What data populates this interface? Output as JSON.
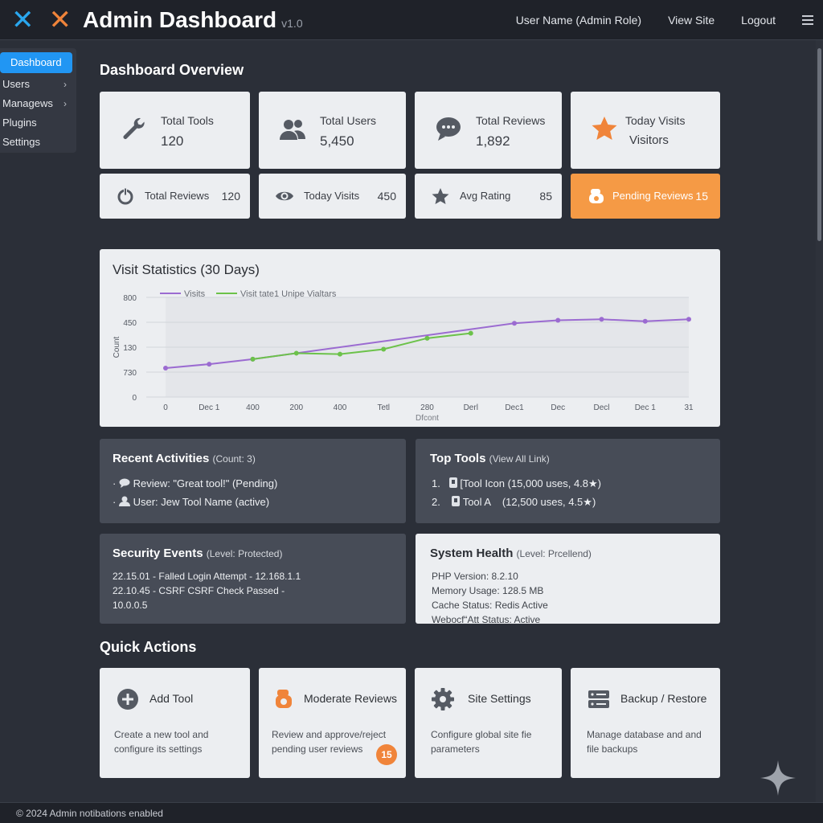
{
  "header": {
    "title": "Admin Dashboard",
    "version": "v1.0",
    "user": "User Name (Admin Role)",
    "view_site": "View Site",
    "logout": "Logout"
  },
  "sidebar": {
    "items": [
      {
        "label": "Dashboard",
        "active": true
      },
      {
        "label": "Users",
        "has_children": true
      },
      {
        "label": "Managews",
        "has_children": true
      },
      {
        "label": "Plugins"
      },
      {
        "label": "Settings"
      }
    ]
  },
  "overview": {
    "title": "Dashboard Overview",
    "big_stats": [
      {
        "label": "Total Tools",
        "value": "120",
        "icon": "wrench-icon"
      },
      {
        "label": "Total Users",
        "value": "5,450",
        "icon": "users-icon"
      },
      {
        "label": "Total Reviews",
        "value": "1,892",
        "icon": "chat-icon"
      },
      {
        "label": "Today Visits",
        "value": "Visitors",
        "icon": "star-icon"
      }
    ],
    "small_stats": [
      {
        "label": "Total Reviews",
        "value": "120",
        "icon": "power-icon"
      },
      {
        "label": "Today Visits",
        "value": "450",
        "icon": "eye-icon"
      },
      {
        "label": "Avg Rating",
        "value": "85",
        "icon": "star-icon"
      },
      {
        "label": "Pending Reviews",
        "value": "15",
        "icon": "review-icon",
        "highlight": true
      }
    ]
  },
  "chart_data": {
    "type": "line",
    "title": "Visit Statistics (30 Days)",
    "legend": [
      "Visits",
      "Visit tate1 Unipe Vialtars"
    ],
    "x": [
      "0",
      "Dec 1",
      "400",
      "200",
      "400",
      "Tetl",
      "280",
      "Derl",
      "Dec1",
      "Dec",
      "Decl",
      "Dec 1",
      "31"
    ],
    "y_tick_labels": [
      "0",
      "730",
      "130",
      "450",
      "800"
    ],
    "ylabel": "Count",
    "xlabel": "Dfcont",
    "series": [
      {
        "name": "Visits",
        "color": "#9b6bd1",
        "values": [
          0.29,
          0.33,
          0.38,
          null,
          null,
          null,
          null,
          null,
          0.74,
          0.77,
          0.78,
          0.76,
          0.78
        ]
      },
      {
        "name": "Visit tate1 Unipe Vialtars",
        "color": "#6cc24a",
        "values": [
          null,
          null,
          0.38,
          0.44,
          0.43,
          0.48,
          0.59,
          0.64,
          null,
          null,
          null,
          null,
          null
        ]
      }
    ],
    "ylim": [
      0,
      1
    ],
    "grid": true,
    "legend_position": "top-left"
  },
  "recent_activities": {
    "title": "Recent Activities",
    "sub": "(Count: 3)",
    "items": [
      {
        "text": "Review: \"Great tool!\" (Pending)",
        "icon": "comment-icon"
      },
      {
        "text": "User: Jew Tool Name (active)",
        "icon": "user-icon"
      }
    ]
  },
  "top_tools": {
    "title": "Top Tools",
    "sub": "(View All Link)",
    "items": [
      {
        "rank": "1.",
        "text": "[Tool Icon (15,000 uses, 4.8★)"
      },
      {
        "rank": "2.",
        "text": "Tool A    (12,500 uses, 4.5★)"
      }
    ]
  },
  "security": {
    "title": "Security Events",
    "sub": "(Level: Protected)",
    "lines": [
      "22.15.01 - Falled Login Attempt - 12.168.1.1",
      "22.10.45 - CSRF CSRF Check Passed -",
      "10.0.0.5"
    ]
  },
  "health": {
    "title": "System Health",
    "sub": "(Level: Prcellend)",
    "lines": [
      "PHP Version: 8.2.10",
      "Memory Usage: 128.5 MB",
      "Cache Status: Redis Active",
      "Webocf“Att Status: Active"
    ]
  },
  "quick_actions": {
    "title": "Quick Actions",
    "items": [
      {
        "label": "Add Tool",
        "desc": "Create a new tool and configure its settings",
        "icon": "plus-circle-icon"
      },
      {
        "label": "Moderate Reviews",
        "desc": "Review and approve/reject pending user reviews",
        "icon": "review-icon",
        "badge": "15"
      },
      {
        "label": "Site Settings",
        "desc": "Configure global site fie parameters",
        "icon": "gear-icon"
      },
      {
        "label": "Backup / Restore",
        "desc": "Manage database and and file backups",
        "icon": "server-icon"
      }
    ]
  },
  "footer": {
    "text": "© 2024 Admin notibations enabled"
  },
  "colors": {
    "accent_blue": "#2196f3",
    "accent_orange": "#f59a45",
    "background": "#2b2f38",
    "card": "#eceef1",
    "panel_dark": "#474c57"
  }
}
